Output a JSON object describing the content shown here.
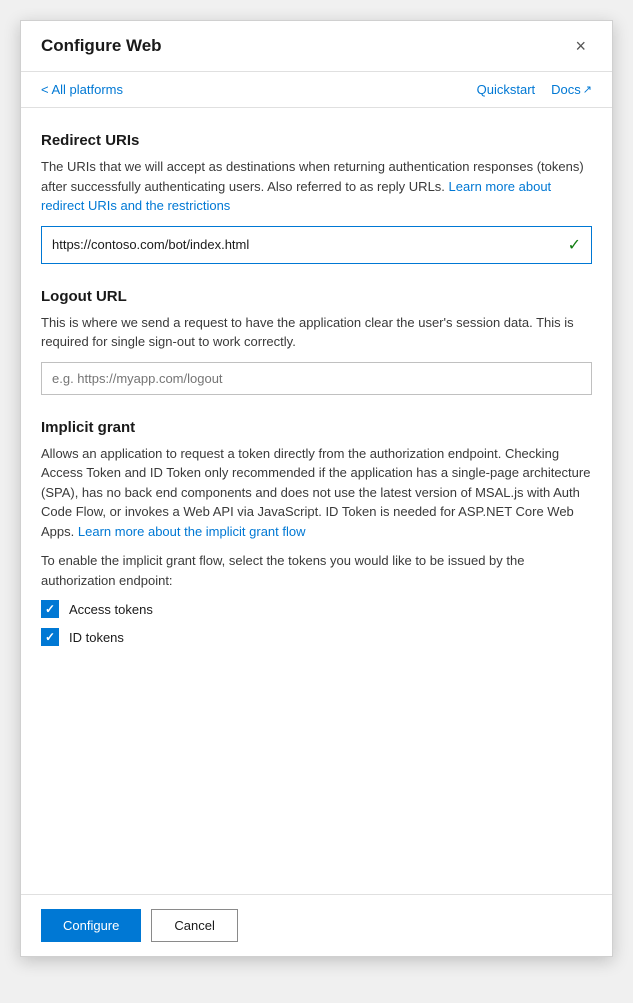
{
  "modal": {
    "title": "Configure Web",
    "close_label": "×"
  },
  "nav": {
    "back_label": "< All platforms",
    "quickstart_label": "Quickstart",
    "docs_label": "Docs"
  },
  "redirect_uris": {
    "section_title": "Redirect URIs",
    "description": "The URIs that we will accept as destinations when returning authentication responses (tokens) after successfully authenticating users. Also referred to as reply URLs.",
    "learn_more_text": "Learn more about redirect URIs and the restrictions",
    "input_value": "https://contoso.com/bot/index.html",
    "input_valid": "✓"
  },
  "logout_url": {
    "section_title": "Logout URL",
    "description": "This is where we send a request to have the application clear the user's session data. This is required for single sign-out to work correctly.",
    "placeholder": "e.g. https://myapp.com/logout"
  },
  "implicit_grant": {
    "section_title": "Implicit grant",
    "description": "Allows an application to request a token directly from the authorization endpoint. Checking Access Token and ID Token only recommended if the application has a single-page architecture (SPA), has no back end components and does not use the latest version of MSAL.js with Auth Code Flow, or invokes a Web API via JavaScript. ID Token is needed for ASP.NET Core Web Apps.",
    "learn_more_text": "Learn more about the implicit grant flow",
    "enable_text": "To enable the implicit grant flow, select the tokens you would like to be issued by the authorization endpoint:",
    "checkboxes": [
      {
        "label": "Access tokens",
        "checked": true
      },
      {
        "label": "ID tokens",
        "checked": true
      }
    ]
  },
  "footer": {
    "configure_label": "Configure",
    "cancel_label": "Cancel"
  }
}
